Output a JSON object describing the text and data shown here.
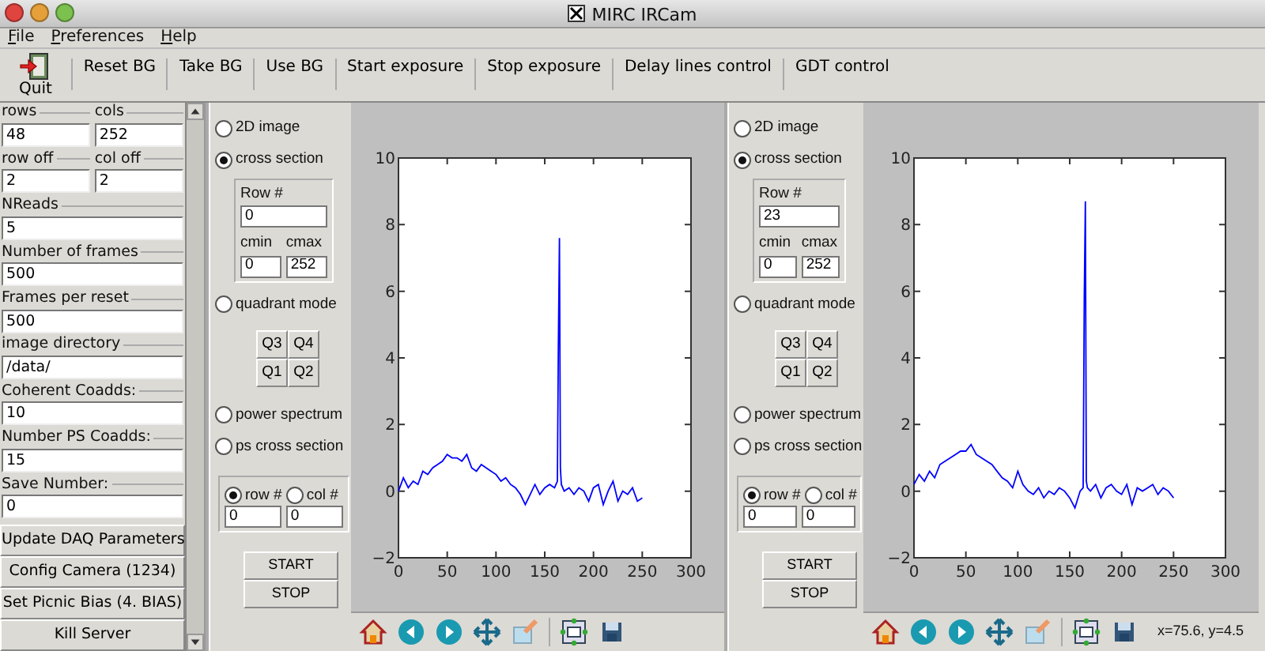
{
  "window": {
    "title": "MIRC IRCam"
  },
  "menu": [
    "File",
    "Preferences",
    "Help"
  ],
  "toolbar": {
    "quit": "Quit",
    "buttons": [
      "Reset BG",
      "Take BG",
      "Use BG",
      "Start exposure",
      "Stop exposure",
      "Delay lines control",
      "GDT control"
    ]
  },
  "fields": [
    {
      "kind": "pair",
      "items": [
        {
          "label": "rows",
          "value": "48"
        },
        {
          "label": "cols",
          "value": "252"
        }
      ]
    },
    {
      "kind": "pair",
      "items": [
        {
          "label": "row off",
          "value": "2"
        },
        {
          "label": "col off",
          "value": "2"
        }
      ]
    },
    {
      "kind": "single",
      "items": [
        {
          "label": "NReads",
          "value": "5"
        }
      ]
    },
    {
      "kind": "single",
      "items": [
        {
          "label": "Number of frames",
          "value": "500"
        }
      ]
    },
    {
      "kind": "single",
      "items": [
        {
          "label": "Frames per reset",
          "value": "500"
        }
      ]
    },
    {
      "kind": "single",
      "items": [
        {
          "label": "image directory",
          "value": "/data/"
        }
      ]
    },
    {
      "kind": "single",
      "items": [
        {
          "label": "Coherent Coadds:",
          "value": "10"
        }
      ]
    },
    {
      "kind": "single",
      "items": [
        {
          "label": "Number PS Coadds:",
          "value": "15"
        }
      ]
    },
    {
      "kind": "single",
      "items": [
        {
          "label": "Save Number:",
          "value": "0"
        }
      ]
    }
  ],
  "actions": [
    "Update DAQ Parameters",
    "Config Camera (1234)",
    "Set Picnic Bias (4. BIAS)",
    "Kill Server"
  ],
  "panels": [
    {
      "modes": [
        {
          "label": "2D image",
          "kind": "plain",
          "selected": false
        },
        {
          "label": "cross section",
          "kind": "cross",
          "selected": true
        },
        {
          "label": "quadrant mode",
          "kind": "quadrant",
          "selected": false
        },
        {
          "label": "power spectrum",
          "kind": "plain",
          "selected": false
        },
        {
          "label": "ps cross section",
          "kind": "plain",
          "selected": false
        }
      ],
      "row_label": "Row #",
      "row_value": "0",
      "cmin_label": "cmin",
      "cmin_value": "0",
      "cmax_label": "cmax",
      "cmax_value": "252",
      "quadrants": [
        "Q3",
        "Q4",
        "Q1",
        "Q2"
      ],
      "axis_choice": [
        {
          "label": "row #",
          "selected": true
        },
        {
          "label": "col #",
          "selected": false
        }
      ],
      "axis_values": [
        "0",
        "0"
      ],
      "start": "START",
      "stop": "STOP",
      "chart_data": {
        "type": "line",
        "xlim": [
          0,
          300
        ],
        "ylim": [
          -2,
          10
        ],
        "xticks": [
          0,
          50,
          100,
          150,
          200,
          250,
          300
        ],
        "yticks": [
          {
            "value": -2,
            "label": "−2"
          },
          0,
          2,
          4,
          6,
          8,
          10
        ],
        "x": [
          0,
          5,
          10,
          15,
          20,
          25,
          30,
          35,
          40,
          45,
          50,
          55,
          60,
          65,
          70,
          75,
          80,
          85,
          90,
          95,
          100,
          105,
          110,
          115,
          120,
          125,
          130,
          135,
          140,
          145,
          150,
          155,
          160,
          163,
          164,
          165,
          166,
          167,
          170,
          175,
          180,
          185,
          190,
          195,
          200,
          205,
          210,
          215,
          220,
          225,
          230,
          235,
          240,
          245,
          250
        ],
        "series": [
          {
            "color": "#0000ff",
            "values": [
              0,
              0.4,
              0.1,
              0.3,
              0.2,
              0.6,
              0.5,
              0.7,
              0.8,
              0.9,
              1.1,
              1.0,
              1.0,
              0.9,
              1.1,
              0.7,
              0.6,
              0.8,
              0.7,
              0.6,
              0.5,
              0.3,
              0.4,
              0.2,
              0.1,
              -0.1,
              -0.4,
              -0.1,
              0.2,
              -0.1,
              0.1,
              0.2,
              0.1,
              0.3,
              4.3,
              7.6,
              0.7,
              0.2,
              0.0,
              0.1,
              -0.1,
              0.1,
              0.0,
              -0.3,
              0.1,
              0.2,
              -0.4,
              0.0,
              0.3,
              -0.3,
              0.0,
              -0.1,
              0.1,
              -0.3,
              -0.2
            ]
          }
        ]
      }
    },
    {
      "modes": [
        {
          "label": "2D image",
          "kind": "plain",
          "selected": false
        },
        {
          "label": "cross section",
          "kind": "cross",
          "selected": true
        },
        {
          "label": "quadrant mode",
          "kind": "quadrant",
          "selected": false
        },
        {
          "label": "power spectrum",
          "kind": "plain",
          "selected": false
        },
        {
          "label": "ps cross section",
          "kind": "plain",
          "selected": false
        }
      ],
      "row_label": "Row #",
      "row_value": "23",
      "cmin_label": "cmin",
      "cmin_value": "0",
      "cmax_label": "cmax",
      "cmax_value": "252",
      "quadrants": [
        "Q3",
        "Q4",
        "Q1",
        "Q2"
      ],
      "axis_choice": [
        {
          "label": "row #",
          "selected": true
        },
        {
          "label": "col #",
          "selected": false
        }
      ],
      "axis_values": [
        "0",
        "0"
      ],
      "start": "START",
      "stop": "STOP",
      "chart_data": {
        "type": "line",
        "xlim": [
          0,
          300
        ],
        "ylim": [
          -2,
          10
        ],
        "xticks": [
          0,
          50,
          100,
          150,
          200,
          250,
          300
        ],
        "yticks": [
          {
            "value": -2,
            "label": "−2"
          },
          0,
          2,
          4,
          6,
          8,
          10
        ],
        "x": [
          0,
          5,
          10,
          15,
          20,
          25,
          30,
          35,
          40,
          45,
          50,
          55,
          60,
          65,
          70,
          75,
          80,
          85,
          90,
          95,
          100,
          105,
          110,
          115,
          120,
          125,
          130,
          135,
          140,
          145,
          150,
          155,
          160,
          163,
          164,
          165,
          166,
          167,
          170,
          175,
          180,
          185,
          190,
          195,
          200,
          205,
          210,
          215,
          220,
          225,
          230,
          235,
          240,
          245,
          250
        ],
        "series": [
          {
            "color": "#0000ff",
            "values": [
              0.2,
              0.5,
              0.3,
              0.6,
              0.4,
              0.8,
              0.9,
              1.0,
              1.1,
              1.2,
              1.2,
              1.4,
              1.1,
              1.0,
              0.9,
              0.8,
              0.6,
              0.4,
              0.3,
              0.1,
              0.6,
              0.2,
              0.0,
              -0.1,
              0.1,
              -0.2,
              0.0,
              -0.1,
              0.1,
              0.0,
              -0.2,
              -0.5,
              0.0,
              0.1,
              5.8,
              8.7,
              0.3,
              0.1,
              0.0,
              0.2,
              -0.2,
              0.1,
              0.2,
              0.0,
              -0.1,
              0.2,
              -0.4,
              0.1,
              0.0,
              0.1,
              0.2,
              -0.1,
              0.1,
              0.0,
              -0.2
            ]
          }
        ]
      }
    }
  ],
  "status": "x=75.6, y=4.5"
}
